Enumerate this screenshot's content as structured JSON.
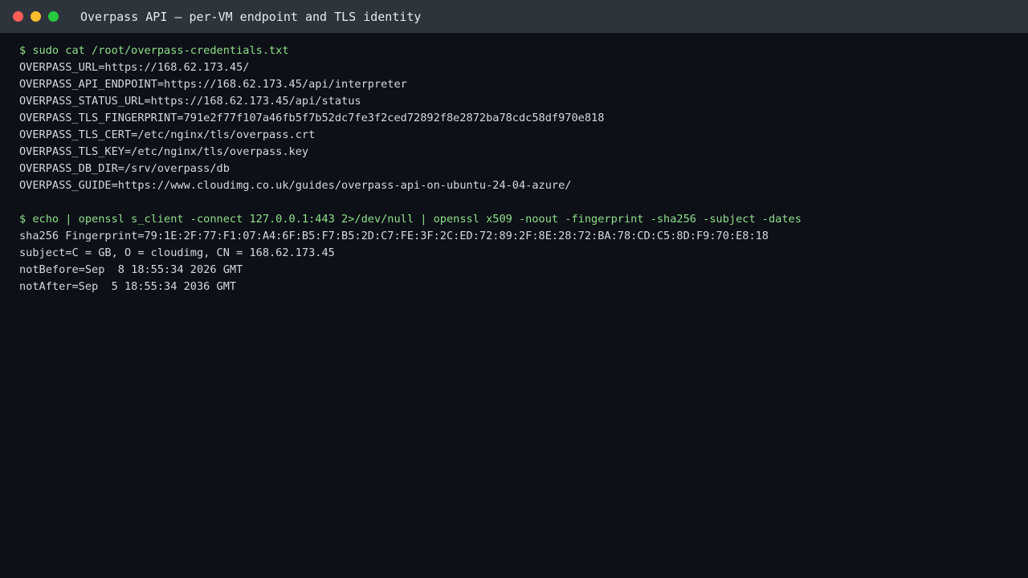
{
  "window": {
    "title": "Overpass API — per-VM endpoint and TLS identity",
    "controls": [
      "close",
      "minimize",
      "maximize"
    ]
  },
  "colors": {
    "background": "#0d1017",
    "titlebar": "#2e343c",
    "command": "#8fe08a",
    "output": "#d5d9de"
  },
  "terminal": {
    "block1": {
      "command": "$ sudo cat /root/overpass-credentials.txt",
      "output": [
        "OVERPASS_URL=https://168.62.173.45/",
        "OVERPASS_API_ENDPOINT=https://168.62.173.45/api/interpreter",
        "OVERPASS_STATUS_URL=https://168.62.173.45/api/status",
        "OVERPASS_TLS_FINGERPRINT=791e2f77f107a46fb5f7b52dc7fe3f2ced72892f8e2872ba78cdc58df970e818",
        "OVERPASS_TLS_CERT=/etc/nginx/tls/overpass.crt",
        "OVERPASS_TLS_KEY=/etc/nginx/tls/overpass.key",
        "OVERPASS_DB_DIR=/srv/overpass/db",
        "OVERPASS_GUIDE=https://www.cloudimg.co.uk/guides/overpass-api-on-ubuntu-24-04-azure/"
      ]
    },
    "block2": {
      "command": "$ echo | openssl s_client -connect 127.0.0.1:443 2>/dev/null | openssl x509 -noout -fingerprint -sha256 -subject -dates",
      "output": [
        "sha256 Fingerprint=79:1E:2F:77:F1:07:A4:6F:B5:F7:B5:2D:C7:FE:3F:2C:ED:72:89:2F:8E:28:72:BA:78:CD:C5:8D:F9:70:E8:18",
        "subject=C = GB, O = cloudimg, CN = 168.62.173.45",
        "notBefore=Sep  8 18:55:34 2026 GMT",
        "notAfter=Sep  5 18:55:34 2036 GMT"
      ]
    }
  }
}
